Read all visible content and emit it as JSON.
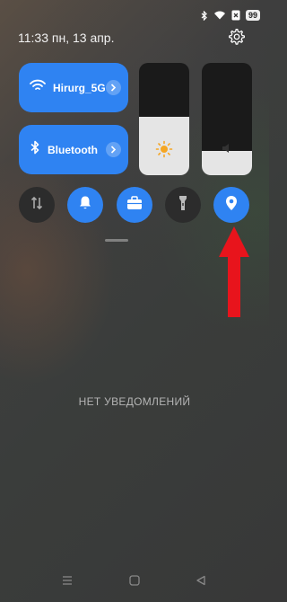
{
  "status": {
    "battery": "99"
  },
  "header": {
    "time": "11:33",
    "date": "пн, 13 апр."
  },
  "tiles": {
    "wifi": {
      "label": "Hirurg_5G"
    },
    "bluetooth": {
      "label": "Bluetooth"
    }
  },
  "sliders": {
    "brightness": {
      "level": 0.52
    },
    "volume": {
      "level": 0.22
    }
  },
  "toggles": [
    {
      "name": "mobile-data",
      "on": false
    },
    {
      "name": "sound",
      "on": true
    },
    {
      "name": "work-mode",
      "on": true
    },
    {
      "name": "flashlight",
      "on": false
    },
    {
      "name": "location",
      "on": true
    }
  ],
  "notifications": {
    "empty_text": "НЕТ УВЕДОМЛЕНИЙ"
  },
  "colors": {
    "accent": "#2f83f2",
    "arrow": "#e8141c"
  }
}
